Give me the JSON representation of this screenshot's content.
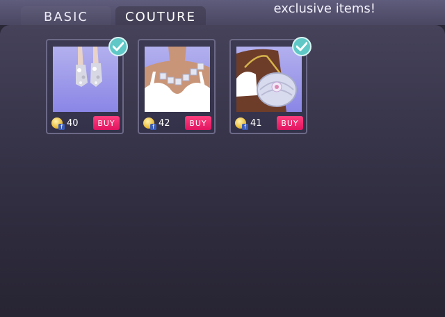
{
  "tabs": [
    {
      "label": "BASIC",
      "active": false
    },
    {
      "label": "COUTURE",
      "active": true
    }
  ],
  "promo_text": "exclusive items!",
  "items": [
    {
      "image": "silver-sparkle-boots",
      "price": "40",
      "buy_label": "BUY",
      "owned": true,
      "owned_icon": "checkmark-icon",
      "currency_icon": "coin-icon"
    },
    {
      "image": "crystal-chain-necklace",
      "price": "42",
      "buy_label": "BUY",
      "owned": false,
      "currency_icon": "coin-icon"
    },
    {
      "image": "jeweled-clutch-bag",
      "price": "41",
      "buy_label": "BUY",
      "owned": true,
      "owned_icon": "checkmark-icon",
      "currency_icon": "coin-icon"
    }
  ],
  "colors": {
    "buy_button": "#e81a66",
    "check_badge": "#5fc8c7",
    "thumb_background": "#9e9bea",
    "panel_background": "#2e2b3d"
  }
}
